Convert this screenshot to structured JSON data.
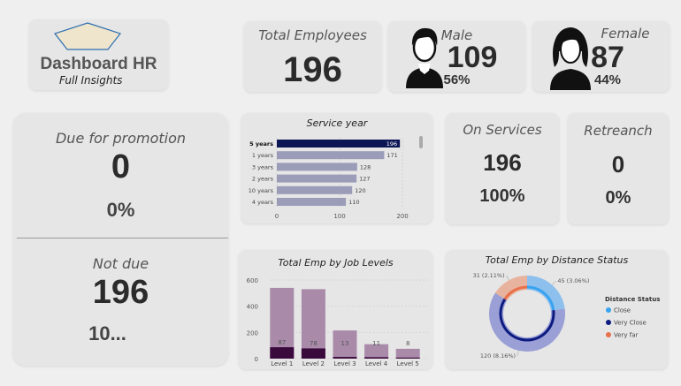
{
  "header": {
    "title": "Dashboard HR",
    "subtitle": "Full Insights"
  },
  "total_employees": {
    "label": "Total Employees",
    "value": "196"
  },
  "male": {
    "label": "Male",
    "value": "109",
    "pct": "56%"
  },
  "female": {
    "label": "Female",
    "value": "87",
    "pct": "44%"
  },
  "promotion": {
    "due_label": "Due for promotion",
    "due_value": "0",
    "due_pct": "0%",
    "not_due_label": "Not due",
    "not_due_value": "196",
    "not_due_pct": "10..."
  },
  "on_services": {
    "label": "On Services",
    "value": "196",
    "pct": "100%"
  },
  "retreanch": {
    "label": "Retreanch",
    "value": "0",
    "pct": "0%"
  },
  "colors": {
    "navy": "#0d1654",
    "bar_grey": "#9b9cb8",
    "bar_mauve": "#a98ba9",
    "bar_dark": "#3b0a3d",
    "close": "#38a3f0",
    "very_close": "#0d1b80",
    "very_far": "#e8704a"
  },
  "chart_data": [
    {
      "type": "bar",
      "orientation": "horizontal",
      "title": "Service year",
      "categories": [
        "5 years",
        "1 years",
        "3 years",
        "2 years",
        "10 years",
        "4 years"
      ],
      "values": [
        196,
        171,
        128,
        127,
        120,
        110
      ],
      "xlim": [
        0,
        200
      ],
      "xticks": [
        0,
        100,
        200
      ],
      "highlighted": "5 years"
    },
    {
      "type": "bar",
      "title": "Total Emp by Job Levels",
      "categories": [
        "Level 1",
        "Level 2",
        "Level 3",
        "Level 4",
        "Level 5"
      ],
      "series": [
        {
          "values": [
            540,
            530,
            215,
            110,
            75
          ]
        },
        {
          "values": [
            87,
            78,
            13,
            11,
            8
          ]
        }
      ],
      "ylim": [
        0,
        600
      ],
      "yticks": [
        0,
        200,
        400,
        600
      ]
    },
    {
      "type": "pie",
      "title": "Total Emp by Distance Status",
      "legend_title": "Distance Status",
      "legend_position": "right",
      "slices": [
        {
          "name": "Close",
          "value": 45,
          "label": "45 (3.06%)"
        },
        {
          "name": "Very Close",
          "value": 120,
          "label": "120 (8.16%)"
        },
        {
          "name": "Very far",
          "value": 31,
          "label": "31 (2.11%)"
        }
      ]
    }
  ]
}
